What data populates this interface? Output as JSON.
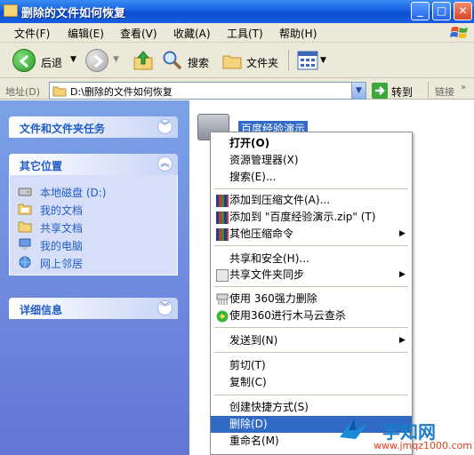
{
  "window": {
    "title": "删除的文件如何恢复"
  },
  "caption_buttons": {
    "minimize": "_",
    "maximize": "□",
    "close": "✕"
  },
  "menubar": [
    {
      "label": "文件(F)"
    },
    {
      "label": "编辑(E)"
    },
    {
      "label": "查看(V)"
    },
    {
      "label": "收藏(A)"
    },
    {
      "label": "工具(T)"
    },
    {
      "label": "帮助(H)"
    }
  ],
  "toolbar": {
    "back_label": "后退",
    "search_label": "搜索",
    "folders_label": "文件夹"
  },
  "address": {
    "label": "地址(D)",
    "value": "D:\\删除的文件如何恢复",
    "go_label": "转到",
    "links_label": "链接"
  },
  "taskpane": {
    "file_tasks_title": "文件和文件夹任务",
    "other_places_title": "其它位置",
    "other_places": [
      {
        "label": "本地磁盘 (D:)",
        "icon": "drive-icon"
      },
      {
        "label": "我的文档",
        "icon": "folder-icon"
      },
      {
        "label": "共享文档",
        "icon": "folder-icon"
      },
      {
        "label": "我的电脑",
        "icon": "computer-icon"
      },
      {
        "label": "网上邻居",
        "icon": "network-icon"
      }
    ],
    "details_title": "详细信息"
  },
  "selected_folder": {
    "label": "百度经验演示"
  },
  "context_menu": {
    "open": "打开(O)",
    "explorer": "资源管理器(X)",
    "search": "搜索(E)...",
    "add_to_archive": "添加到压缩文件(A)...",
    "add_to_zip": "添加到 \"百度经验演示.zip\" (T)",
    "other_compress": "其他压缩命令",
    "sharing_security": "共享和安全(H)...",
    "shared_sync": "共享文件夹同步",
    "force_delete_360": "使用 360强力删除",
    "trojan_scan_360": "使用360进行木马云查杀",
    "send_to": "发送到(N)",
    "cut": "剪切(T)",
    "copy": "复制(C)",
    "create_shortcut": "创建快捷方式(S)",
    "delete": "删除(D)",
    "rename": "重命名(M)"
  },
  "watermark": {
    "brand": "学知网",
    "url": "www.jmqz1000.com"
  },
  "colors": {
    "titlebar": "#0a4fd0",
    "selection": "#316ac5",
    "taskpane_text": "#215dc6"
  }
}
